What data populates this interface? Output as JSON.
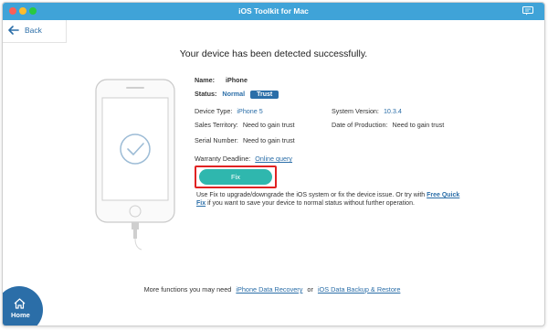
{
  "window": {
    "title": "iOS Toolkit for Mac"
  },
  "nav": {
    "back_label": "Back",
    "home_label": "Home"
  },
  "main": {
    "heading": "Your device has been detected successfully.",
    "name_label": "Name:",
    "name_value": "iPhone",
    "status_label": "Status:",
    "status_value": "Normal",
    "trust_label": "Trust",
    "device_type_label": "Device Type:",
    "device_type_value": "iPhone 5",
    "system_version_label": "System Version:",
    "system_version_value": "10.3.4",
    "sales_territory_label": "Sales Territory:",
    "sales_territory_value": "Need to gain trust",
    "date_production_label": "Date of Production:",
    "date_production_value": "Need to gain trust",
    "serial_label": "Serial Number:",
    "serial_value": "Need to gain trust",
    "warranty_label": "Warranty Deadline:",
    "warranty_link": "Online query",
    "fix_label": "Fix",
    "desc_part1": "Use Fix to upgrade/downgrade the iOS system or fix the device issue. Or try with ",
    "desc_link": "Free Quick Fix",
    "desc_part2": " if you want to save your device to normal status without further operation."
  },
  "footer": {
    "prefix": "More functions you may need",
    "link1": "iPhone Data Recovery",
    "or": "or",
    "link2": "iOS Data Backup & Restore"
  },
  "colors": {
    "titlebar": "#3fa3d8",
    "accent": "#2b6ea8",
    "fix": "#2fb7ae",
    "highlight": "#e02222"
  }
}
